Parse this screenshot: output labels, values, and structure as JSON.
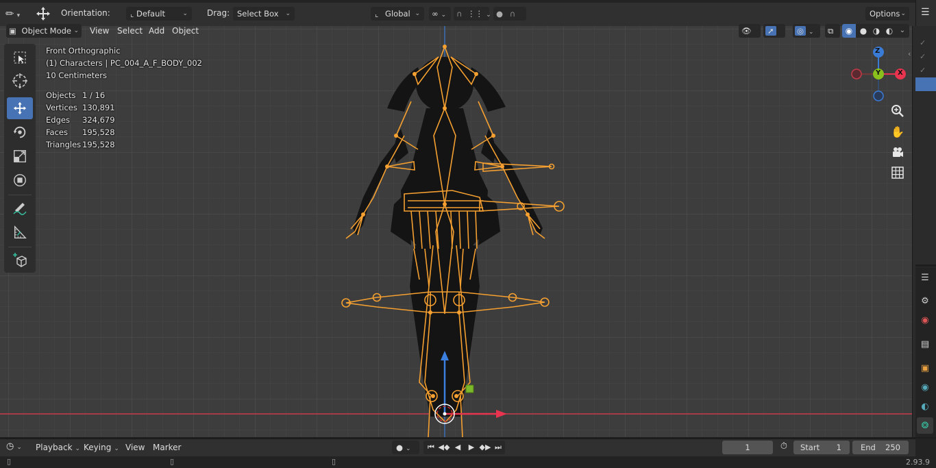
{
  "header": {
    "orientation_label": "Orientation:",
    "orientation_value": "Default",
    "drag_label": "Drag:",
    "drag_value": "Select Box",
    "transform_orientation": "Global",
    "options_label": "Options"
  },
  "menubar": {
    "mode": "Object Mode",
    "items": [
      "View",
      "Select",
      "Add",
      "Object"
    ]
  },
  "overlay": {
    "view_name": "Front Orthographic",
    "collection_line": "(1) Characters | PC_004_A_F_BODY_002",
    "scale_line": "10 Centimeters",
    "stats": [
      {
        "label": "Objects",
        "value": "1 / 16"
      },
      {
        "label": "Vertices",
        "value": "130,891"
      },
      {
        "label": "Edges",
        "value": "324,679"
      },
      {
        "label": "Faces",
        "value": "195,528"
      },
      {
        "label": "Triangles",
        "value": "195,528"
      }
    ]
  },
  "gizmo": {
    "z": "Z",
    "y": "Y",
    "x": "X"
  },
  "timeline": {
    "menus": [
      "Playback",
      "Keying",
      "View",
      "Marker"
    ],
    "current_frame": "1",
    "start_label": "Start",
    "start_value": "1",
    "end_label": "End",
    "end_value": "250"
  },
  "status": {
    "version": "2.93.9"
  },
  "colors": {
    "accent": "#4772b3",
    "bone": "#f5a030",
    "x_axis": "#e8344f",
    "y_axis": "#8ac01c",
    "z_axis": "#3a7bd5"
  },
  "icons": [
    "move-icon",
    "cursor-icon",
    "select-box-icon",
    "rotate-icon",
    "scale-icon",
    "transform-icon",
    "annotate-icon",
    "measure-icon",
    "add-cube-icon",
    "zoom-icon",
    "hand-icon",
    "camera-icon",
    "grid-icon"
  ]
}
